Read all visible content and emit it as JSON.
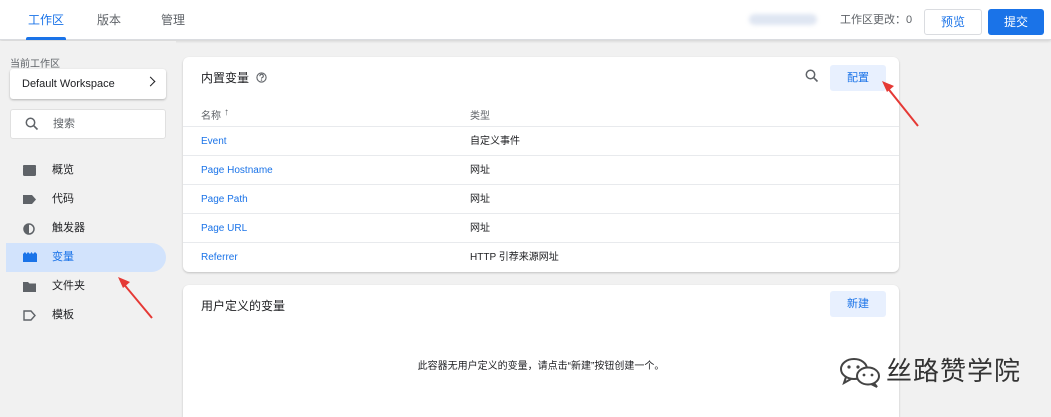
{
  "topbar": {
    "tabs": [
      {
        "label": "工作区",
        "active": true
      },
      {
        "label": "版本",
        "active": false
      },
      {
        "label": "管理",
        "active": false
      }
    ],
    "workspace_changes_label": "工作区更改：0",
    "preview_label": "预览",
    "submit_label": "提交"
  },
  "sidebar": {
    "current_workspace_label": "当前工作区",
    "workspace_name": "Default Workspace",
    "search_placeholder": "搜索",
    "items": [
      {
        "label": "概览",
        "icon": "overview-icon",
        "active": false
      },
      {
        "label": "代码",
        "icon": "tag-icon",
        "active": false
      },
      {
        "label": "触发器",
        "icon": "trigger-icon",
        "active": false
      },
      {
        "label": "变量",
        "icon": "variable-icon",
        "active": true
      },
      {
        "label": "文件夹",
        "icon": "folder-icon",
        "active": false
      },
      {
        "label": "模板",
        "icon": "template-icon",
        "active": false
      }
    ]
  },
  "builtin": {
    "title": "内置变量",
    "configure_label": "配置",
    "columns": {
      "name": "名称",
      "type": "类型"
    },
    "rows": [
      {
        "name": "Event",
        "type": "自定义事件"
      },
      {
        "name": "Page Hostname",
        "type": "网址"
      },
      {
        "name": "Page Path",
        "type": "网址"
      },
      {
        "name": "Page URL",
        "type": "网址"
      },
      {
        "name": "Referrer",
        "type": "HTTP 引荐来源网址"
      }
    ]
  },
  "user_defined": {
    "title": "用户定义的变量",
    "new_label": "新建",
    "empty_message": "此容器无用户定义的变量，请点击“新建”按钮创建一个。"
  },
  "watermark": {
    "text": "丝路赞学院"
  },
  "colors": {
    "accent": "#1a73e8",
    "active_nav_bg": "#d2e3fc",
    "annotation_arrow": "#e53935"
  }
}
